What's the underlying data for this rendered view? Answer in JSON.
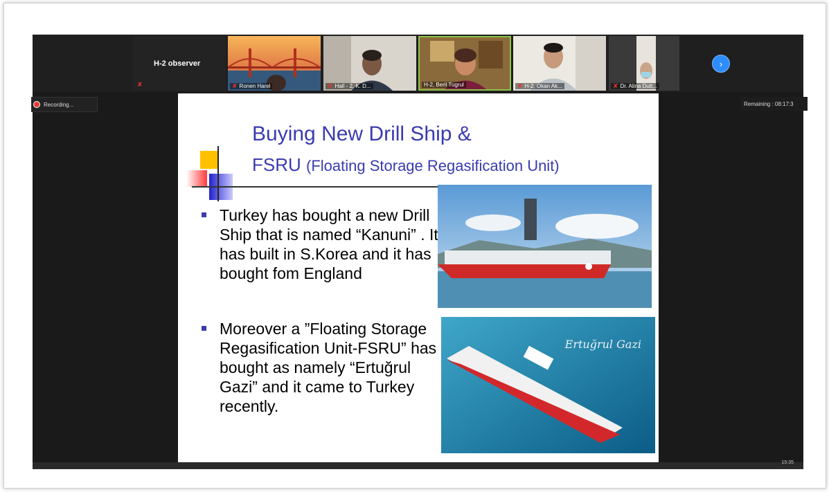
{
  "window": {
    "observer_label": "H-2 observer",
    "recording_label": "Recording...",
    "remaining_label": "Remaining : 08:17:3",
    "clock": "15:35"
  },
  "participants": [
    {
      "name": "Ronen Harel"
    },
    {
      "name": "Hall - 2, K. D..."
    },
    {
      "name": "H-2, Beril Tugrul"
    },
    {
      "name": "H-2, Okan Ak..."
    },
    {
      "name": "Dr. Alina Dutt..."
    }
  ],
  "slide": {
    "title_line1": "Buying New Drill Ship &",
    "title_line2_main": "FSRU",
    "title_line2_sub": "(Floating Storage Regasification Unit)",
    "bullet1": "Turkey has bought a new Drill Ship that is named “Kanuni” . It has built in S.Korea and it has bought fom England",
    "bullet2": "Moreover a  ”Floating Storage Regasification Unit-FSRU” has bought as namely “Ertuğrul Gazi” and it came to Turkey recently.",
    "photo2_caption": "Ertuğrul Gazi"
  },
  "colors": {
    "title": "#3a3bb0",
    "accent_blue": "#2d8cff",
    "mic_red": "#e5332a"
  }
}
